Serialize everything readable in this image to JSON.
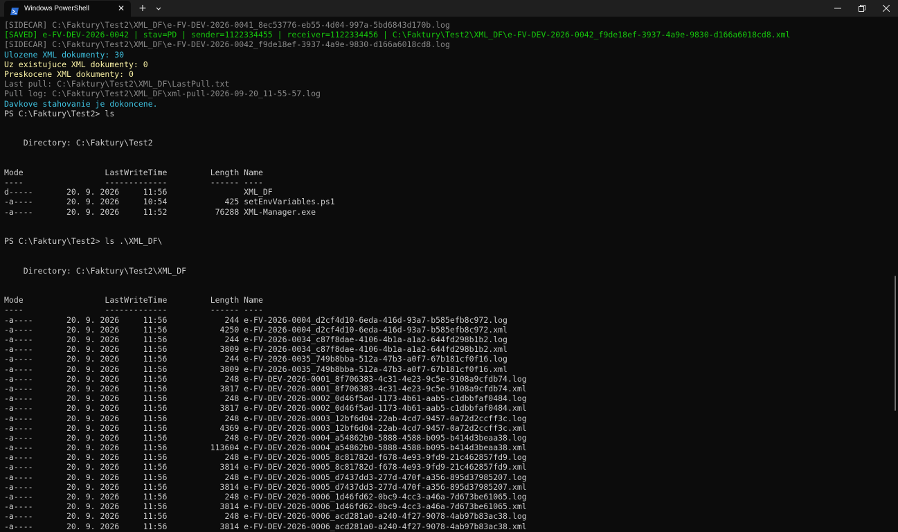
{
  "window": {
    "tab_title": "Windows PowerShell",
    "tab_close_glyph": "✕",
    "new_tab_glyph": "+",
    "icons": {
      "tab": "powershell-icon",
      "dropdown": "chevron-down-icon",
      "minimize": "minimize-icon",
      "maximize": "maximize-icon",
      "close": "close-icon"
    }
  },
  "colors": {
    "background": "#0c0c0c",
    "titlebar": "#1f1f1f",
    "default_text": "#cccccc",
    "gray_text": "#8a8a8a",
    "green_text": "#16c60c",
    "cyan_text": "#3fc2e0",
    "yellow_text": "#f9f1a5"
  },
  "terminal": {
    "lines": [
      {
        "text": "[SIDECAR] C:\\Faktury\\Test2\\XML_DF\\e-FV-DEV-2026-0041_8ec53776-eb55-4d04-997a-5bd6843d170b.log",
        "style": "gray"
      },
      {
        "text": "[SAVED] e-FV-DEV-2026-0042 | stav=PD | sender=1122334455 | receiver=1122334456 | C:\\Faktury\\Test2\\XML_DF\\e-FV-DEV-2026-0042_f9de18ef-3937-4a9e-9830-d166a6018cd8.xml",
        "style": "green"
      },
      {
        "text": "[SIDECAR] C:\\Faktury\\Test2\\XML_DF\\e-FV-DEV-2026-0042_f9de18ef-3937-4a9e-9830-d166a6018cd8.log",
        "style": "gray"
      },
      {
        "text": "Ulozene XML dokumenty: 30",
        "style": "cyan"
      },
      {
        "text": "Uz existujuce XML dokumenty: 0",
        "style": "yellow"
      },
      {
        "text": "Preskocene XML dokumenty: 0",
        "style": "yellow"
      },
      {
        "text": "Last pull: C:\\Faktury\\Test2\\XML_DF\\LastPull.txt",
        "style": "gray"
      },
      {
        "text": "Pull log: C:\\Faktury\\Test2\\XML_DF\\xml-pull-2026-09-20_11-55-57.log",
        "style": "gray"
      },
      {
        "text": "Davkove stahovanie je dokoncene.",
        "style": "cyan"
      },
      {
        "text": "PS C:\\Faktury\\Test2> ls",
        "style": "default"
      },
      {
        "text": "",
        "style": "default"
      },
      {
        "text": "",
        "style": "default"
      },
      {
        "text": "    Directory: C:\\Faktury\\Test2",
        "style": "default"
      },
      {
        "text": "",
        "style": "default"
      },
      {
        "text": "",
        "style": "default"
      },
      {
        "text": "Mode                 LastWriteTime         Length Name",
        "style": "default"
      },
      {
        "text": "----                 -------------         ------ ----",
        "style": "default"
      },
      {
        "text": "d-----       20. 9. 2026     11:56                XML_DF",
        "style": "default"
      },
      {
        "text": "-a----       20. 9. 2026     10:54            425 setEnvVariables.ps1",
        "style": "default"
      },
      {
        "text": "-a----       20. 9. 2026     11:52          76288 XML-Manager.exe",
        "style": "default"
      },
      {
        "text": "",
        "style": "default"
      },
      {
        "text": "",
        "style": "default"
      },
      {
        "text": "PS C:\\Faktury\\Test2> ls .\\XML_DF\\",
        "style": "default"
      },
      {
        "text": "",
        "style": "default"
      },
      {
        "text": "",
        "style": "default"
      },
      {
        "text": "    Directory: C:\\Faktury\\Test2\\XML_DF",
        "style": "default"
      },
      {
        "text": "",
        "style": "default"
      },
      {
        "text": "",
        "style": "default"
      },
      {
        "text": "Mode                 LastWriteTime         Length Name",
        "style": "default"
      },
      {
        "text": "----                 -------------         ------ ----",
        "style": "default"
      },
      {
        "text": "-a----       20. 9. 2026     11:56            244 e-FV-2026-0004_d2cf4d10-6eda-416d-93a7-b585efb8c972.log",
        "style": "default"
      },
      {
        "text": "-a----       20. 9. 2026     11:56           4250 e-FV-2026-0004_d2cf4d10-6eda-416d-93a7-b585efb8c972.xml",
        "style": "default"
      },
      {
        "text": "-a----       20. 9. 2026     11:56            244 e-FV-2026-0034_c87f8dae-4106-4b1a-a1a2-644fd298b1b2.log",
        "style": "default"
      },
      {
        "text": "-a----       20. 9. 2026     11:56           3809 e-FV-2026-0034_c87f8dae-4106-4b1a-a1a2-644fd298b1b2.xml",
        "style": "default"
      },
      {
        "text": "-a----       20. 9. 2026     11:56            244 e-FV-2026-0035_749b8bba-512a-47b3-a0f7-67b181cf0f16.log",
        "style": "default"
      },
      {
        "text": "-a----       20. 9. 2026     11:56           3809 e-FV-2026-0035_749b8bba-512a-47b3-a0f7-67b181cf0f16.xml",
        "style": "default"
      },
      {
        "text": "-a----       20. 9. 2026     11:56            248 e-FV-DEV-2026-0001_8f706383-4c31-4e23-9c5e-9108a9cfdb74.log",
        "style": "default"
      },
      {
        "text": "-a----       20. 9. 2026     11:56           3817 e-FV-DEV-2026-0001_8f706383-4c31-4e23-9c5e-9108a9cfdb74.xml",
        "style": "default"
      },
      {
        "text": "-a----       20. 9. 2026     11:56            248 e-FV-DEV-2026-0002_0d46f5ad-1173-4b61-aab5-c1dbbfaf0484.log",
        "style": "default"
      },
      {
        "text": "-a----       20. 9. 2026     11:56           3817 e-FV-DEV-2026-0002_0d46f5ad-1173-4b61-aab5-c1dbbfaf0484.xml",
        "style": "default"
      },
      {
        "text": "-a----       20. 9. 2026     11:56            248 e-FV-DEV-2026-0003_12bf6d04-22ab-4cd7-9457-0a72d2ccff3c.log",
        "style": "default"
      },
      {
        "text": "-a----       20. 9. 2026     11:56           4369 e-FV-DEV-2026-0003_12bf6d04-22ab-4cd7-9457-0a72d2ccff3c.xml",
        "style": "default"
      },
      {
        "text": "-a----       20. 9. 2026     11:56            248 e-FV-DEV-2026-0004_a54862b0-5888-4588-b095-b414d3beaa38.log",
        "style": "default"
      },
      {
        "text": "-a----       20. 9. 2026     11:56         113604 e-FV-DEV-2026-0004_a54862b0-5888-4588-b095-b414d3beaa38.xml",
        "style": "default"
      },
      {
        "text": "-a----       20. 9. 2026     11:56            248 e-FV-DEV-2026-0005_8c81782d-f678-4e93-9fd9-21c462857fd9.log",
        "style": "default"
      },
      {
        "text": "-a----       20. 9. 2026     11:56           3814 e-FV-DEV-2026-0005_8c81782d-f678-4e93-9fd9-21c462857fd9.xml",
        "style": "default"
      },
      {
        "text": "-a----       20. 9. 2026     11:56            248 e-FV-DEV-2026-0005_d7437dd3-277d-470f-a356-895d37985207.log",
        "style": "default"
      },
      {
        "text": "-a----       20. 9. 2026     11:56           3814 e-FV-DEV-2026-0005_d7437dd3-277d-470f-a356-895d37985207.xml",
        "style": "default"
      },
      {
        "text": "-a----       20. 9. 2026     11:56            248 e-FV-DEV-2026-0006_1d46fd62-0bc9-4cc3-a46a-7d673be61065.log",
        "style": "default"
      },
      {
        "text": "-a----       20. 9. 2026     11:56           3814 e-FV-DEV-2026-0006_1d46fd62-0bc9-4cc3-a46a-7d673be61065.xml",
        "style": "default"
      },
      {
        "text": "-a----       20. 9. 2026     11:56            248 e-FV-DEV-2026-0006_acd281a0-a240-4f27-9078-4ab97b83ac38.log",
        "style": "default"
      },
      {
        "text": "-a----       20. 9. 2026     11:56           3814 e-FV-DEV-2026-0006_acd281a0-a240-4f27-9078-4ab97b83ac38.xml",
        "style": "default"
      }
    ]
  }
}
